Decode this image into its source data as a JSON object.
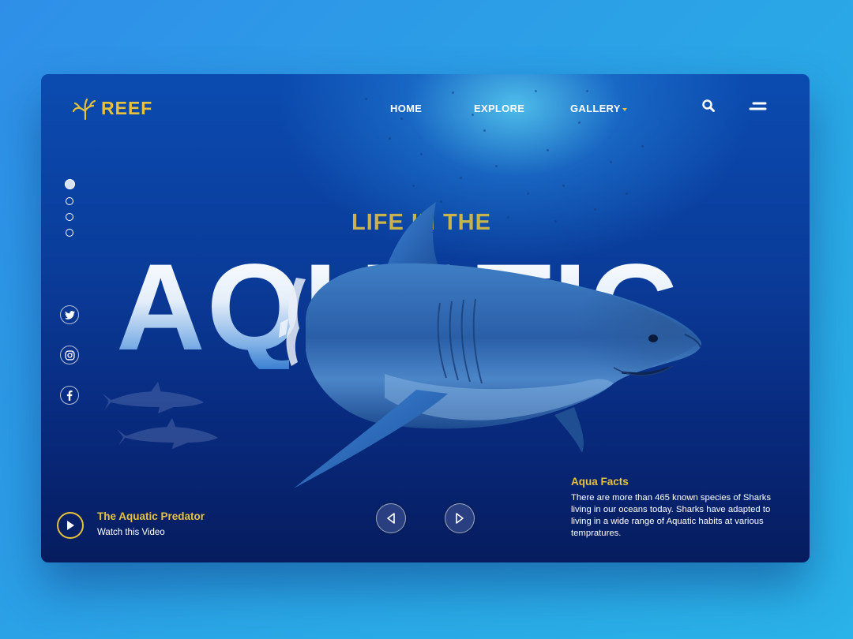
{
  "brand": {
    "name": "REEF",
    "logo_icon": "coral-icon",
    "accent_color": "#e7c23a"
  },
  "nav": {
    "items": [
      {
        "label": "HOME"
      },
      {
        "label": "EXPLORE"
      },
      {
        "label": "GALLERY"
      }
    ],
    "search_icon": "search-icon",
    "menu_icon": "menu-icon"
  },
  "slider": {
    "total": 4,
    "active_index": 0
  },
  "socials": [
    {
      "icon": "twitter-icon"
    },
    {
      "icon": "instagram-icon"
    },
    {
      "icon": "facebook-icon"
    }
  ],
  "hero": {
    "subheading": "LIFE IN THE",
    "heading": "AQUATIC"
  },
  "video": {
    "title": "The Aquatic Predator",
    "subtitle": "Watch this Video"
  },
  "facts": {
    "title": "Aqua Facts",
    "body": "There are more than 465 known species of Sharks living in our oceans today. Sharks have adapted to living in a wide range of Aquatic habits at various tempratures."
  },
  "controls": {
    "prev_icon": "arrow-left-icon",
    "next_icon": "arrow-right-icon"
  }
}
